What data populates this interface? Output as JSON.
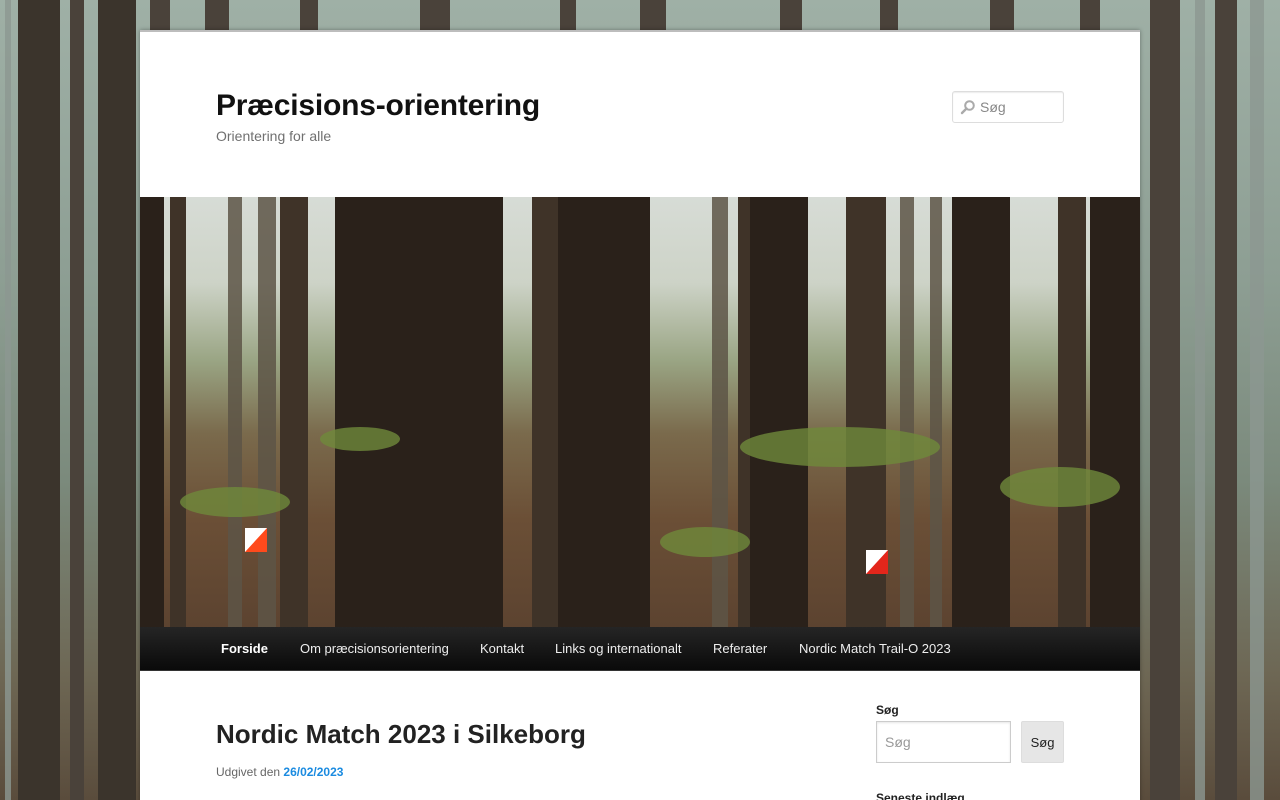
{
  "site": {
    "title": "Præcisions-orientering",
    "description": "Orientering for alle"
  },
  "header_search": {
    "placeholder": "Søg",
    "icon": "search-icon"
  },
  "nav": {
    "items": [
      {
        "label": "Forside",
        "current": true
      },
      {
        "label": "Om præcisionsorientering",
        "current": false
      },
      {
        "label": "Kontakt",
        "current": false
      },
      {
        "label": "Links og internationalt",
        "current": false
      },
      {
        "label": "Referater",
        "current": false
      },
      {
        "label": "Nordic Match Trail-O 2023",
        "current": false
      }
    ]
  },
  "post": {
    "title": "Nordic Match 2023 i Silkeborg",
    "meta_prefix": "Udgivet den",
    "date": "26/02/2023"
  },
  "sidebar": {
    "search_title": "Søg",
    "search_placeholder": "Søg",
    "search_button": "Søg",
    "recent_title": "Seneste indlæg"
  },
  "colors": {
    "nav_bg": "#1a1a1a",
    "link": "#1b8be0",
    "page_bg": "#ffffff"
  }
}
